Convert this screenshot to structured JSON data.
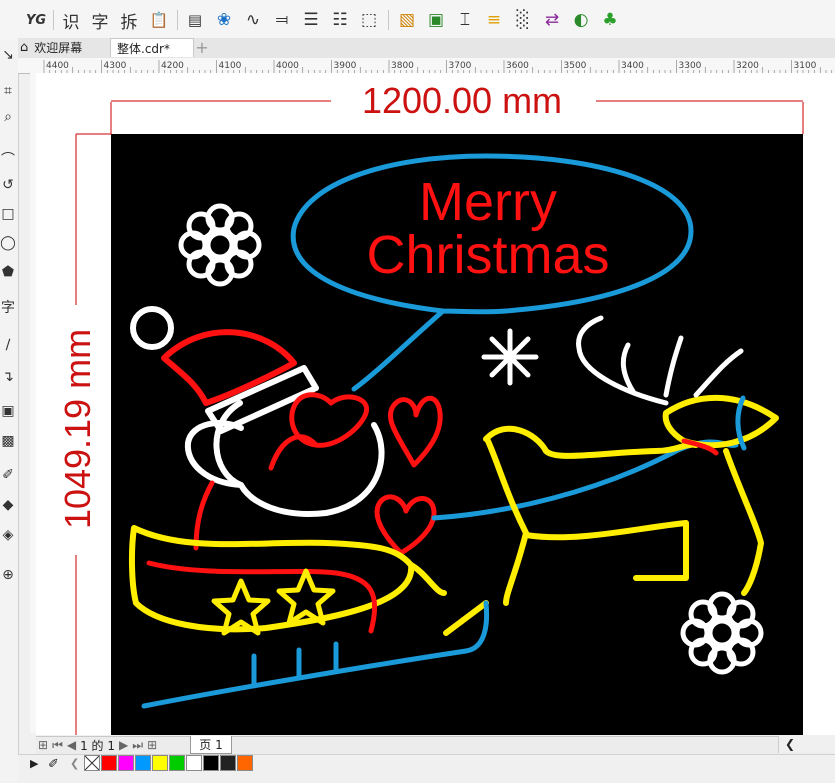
{
  "toolbar": {
    "buttons": [
      {
        "name": "yg-plugin-button",
        "label": "YG"
      },
      {
        "name": "recognize-button",
        "label": "识"
      },
      {
        "name": "text-button",
        "label": "字"
      },
      {
        "name": "split-button",
        "label": "拆"
      }
    ]
  },
  "tabs": {
    "welcome": "欢迎屏幕",
    "document": "整体.cdr*",
    "add": "+"
  },
  "ruler": {
    "h_labels": [
      "4400",
      "4300",
      "4200",
      "4100",
      "4000",
      "3900",
      "3800",
      "3700",
      "3600",
      "3500",
      "3400",
      "3300",
      "3200",
      "3100"
    ]
  },
  "artwork": {
    "width_dim": "1200.00 mm",
    "height_dim": "1049.19 mm",
    "bubble_line1": "Merry",
    "bubble_line2": "Christmas"
  },
  "status": {
    "page_counter": "1 的 1",
    "page_tab": "页 1"
  },
  "palette": {
    "colors": [
      "#ff0000",
      "#ff00ff",
      "#0099ff",
      "#ffff00",
      "#00cc00",
      "#ffffff",
      "#000000",
      "#222222",
      "#ff6600"
    ]
  }
}
